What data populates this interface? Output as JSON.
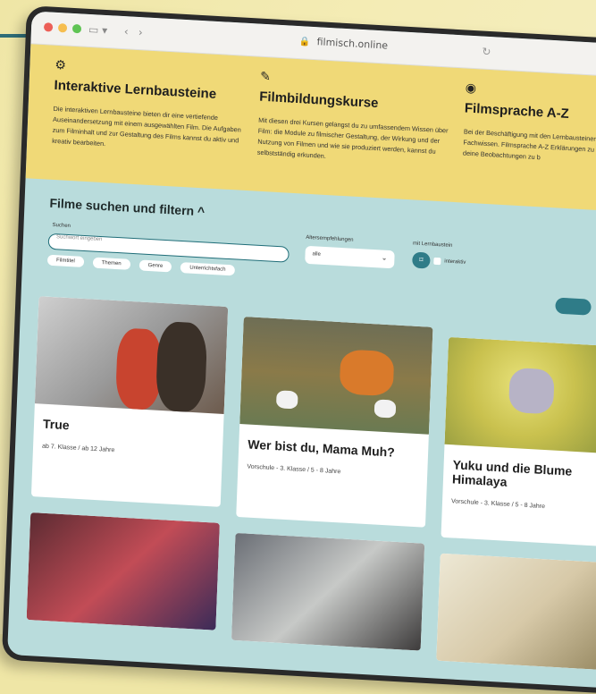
{
  "browser": {
    "url": "filmisch.online"
  },
  "hero": {
    "columns": [
      {
        "title": "Interaktive Lernbausteine",
        "text": "Die interaktiven Lernbausteine bieten dir eine vertiefende Auseinandersetzung mit einem ausgewählten Film. Die Aufgaben zum Filminhalt und zur Gestaltung des Films kannst du aktiv und kreativ bearbeiten."
      },
      {
        "title": "Filmbildungskurse",
        "text": "Mit diesen drei Kursen gelangst du zu umfassendem Wissen über Film: die Module zu filmischer Gestaltung, der Wirkung und der Nutzung von Filmen und wie sie produziert werden, kannst du selbstständig erkunden."
      },
      {
        "title": "Filmsprache A-Z",
        "text": "Bei der Beschäftigung mit den Lernbausteinen und Kursen zu Fachwissen. Filmsprache A-Z Erklärungen zu vorkommender dir, deine Beobachtungen zu b"
      }
    ]
  },
  "search": {
    "title": "Filme suchen und filtern ^",
    "search_label": "Suchen",
    "search_placeholder": "Suchwort eingeben",
    "age_label": "Altersempfehlungen",
    "age_value": "alle",
    "lernbaustein_label": "mit Lernbaustein",
    "interaktiv_label": "interaktiv",
    "chips": [
      "Filmtitel",
      "Themen",
      "Genre",
      "Unterrichtsfach"
    ]
  },
  "films": [
    {
      "title": "True",
      "age": "ab 7. Klasse / ab 12 Jahre"
    },
    {
      "title": "Wer bist du, Mama Muh?",
      "age": "Vorschule - 3. Klasse / 5 - 8 Jahre"
    },
    {
      "title": "Yuku und die Blume Himalaya",
      "age": "Vorschule - 3. Klasse / 5 - 8 Jahre"
    }
  ],
  "colors": {
    "accent": "#2f7c88",
    "hero_bg": "#f0d977",
    "page_bg": "#b9dcdc"
  }
}
